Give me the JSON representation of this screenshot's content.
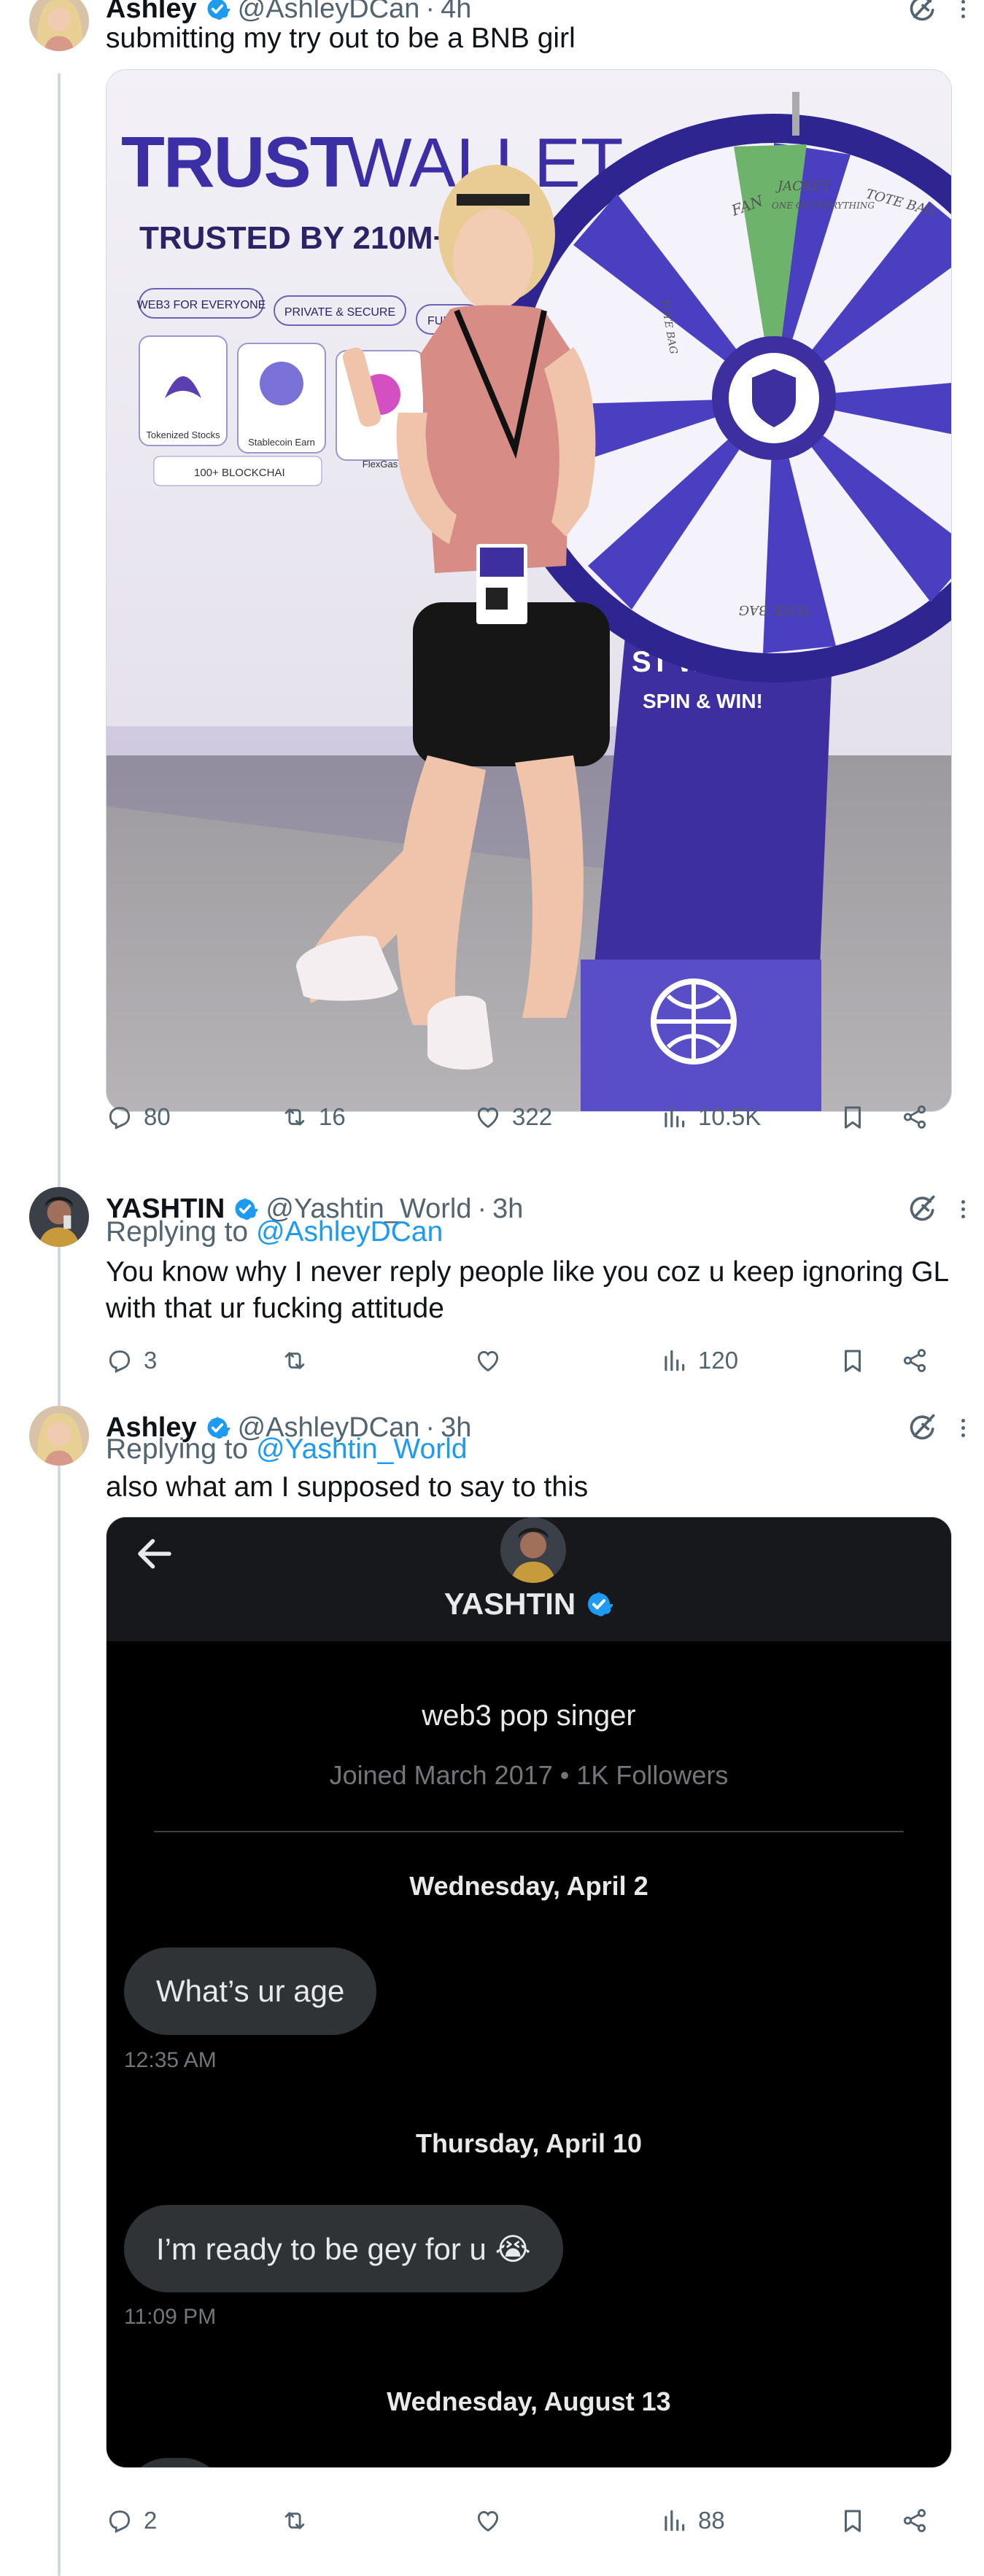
{
  "tweets": [
    {
      "name": "Ashley",
      "handle": "@AshleyDCan",
      "time": "4h",
      "text": "submitting my try out to be a BNB girl",
      "stats": {
        "replies": "80",
        "reposts": "16",
        "likes": "322",
        "views": "10.5K"
      },
      "media": {
        "banner_brand": "TRUST",
        "banner_brand2": "WALLET",
        "banner_tagline": "TRUSTED BY 210M+ PE",
        "pills": [
          "WEB3 FOR EVERYONE",
          "PRIVATE & SECURE",
          "FUL"
        ],
        "cards": [
          "Tokenized Stocks",
          "Stablecoin Earn",
          "FlexGas"
        ],
        "chain_label": "100+ BLOCKCHAI",
        "wheel_labels": [
          "FAN",
          "JACKET",
          "ONE OF EVERYTHING",
          "TOTE BAG",
          "TOTE BAG",
          "TOTE BAG"
        ],
        "wheel_brand": "ST WALLET",
        "wheel_sub": "SPIN & WIN!"
      }
    },
    {
      "name": "YASHTIN",
      "handle": "@Yashtin_World",
      "time": "3h",
      "replying_prefix": "Replying to ",
      "replying_to": "@AshleyDCan",
      "text": "You know why I never reply people like you coz u keep ignoring GL with that ur fucking attitude",
      "stats": {
        "replies": "3",
        "reposts": "",
        "likes": "",
        "views": "120"
      }
    },
    {
      "name": "Ashley",
      "handle": "@AshleyDCan",
      "time": "3h",
      "replying_prefix": "Replying to ",
      "replying_to": "@Yashtin_World",
      "text": "also what am I supposed to say to this",
      "stats": {
        "replies": "2",
        "reposts": "",
        "likes": "",
        "views": "88"
      },
      "dm": {
        "name": "YASHTIN",
        "bio": "web3 pop singer",
        "meta": "Joined March 2017 • 1K Followers",
        "groups": [
          {
            "date": "Wednesday, April 2",
            "message": "What’s ur age",
            "time": "12:35 AM"
          },
          {
            "date": "Thursday, April 10",
            "message": "I’m ready to be gey for u 😭",
            "time": "11:09 PM"
          },
          {
            "date": "Wednesday, August 13"
          }
        ]
      }
    }
  ],
  "dot": "·",
  "colors": {
    "accent": "#1d9bf0",
    "muted": "#536471",
    "dm_bg": "#000000",
    "bubble": "#2f3336"
  },
  "icons": [
    "verified-icon",
    "grok-icon",
    "more-icon",
    "reply-icon",
    "repost-icon",
    "like-icon",
    "views-icon",
    "bookmark-icon",
    "share-icon",
    "back-arrow-icon"
  ]
}
